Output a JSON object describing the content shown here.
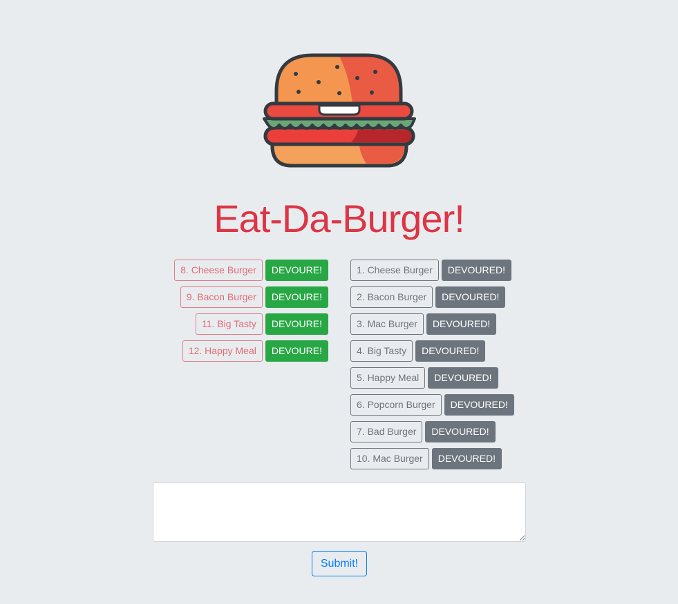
{
  "title": "Eat-Da-Burger!",
  "logo_icon": "burger-icon",
  "colors": {
    "title": "#dc3545",
    "devour_button": "#28a745",
    "devoured_button": "#6c757d",
    "submit_accent": "#007bff",
    "background": "#e9ecef"
  },
  "pending_burgers": [
    {
      "name": "8. Cheese Burger",
      "action": "DEVOURE!"
    },
    {
      "name": "9. Bacon Burger",
      "action": "DEVOURE!"
    },
    {
      "name": "11. Big Tasty",
      "action": "DEVOURE!"
    },
    {
      "name": "12. Happy Meal",
      "action": "DEVOURE!"
    }
  ],
  "devoured_burgers": [
    {
      "name": "1. Cheese Burger",
      "action": "DEVOURED!"
    },
    {
      "name": "2. Bacon Burger",
      "action": "DEVOURED!"
    },
    {
      "name": "3. Mac Burger",
      "action": "DEVOURED!"
    },
    {
      "name": "4. Big Tasty",
      "action": "DEVOURED!"
    },
    {
      "name": "5. Happy Meal",
      "action": "DEVOURED!"
    },
    {
      "name": "6. Popcorn Burger",
      "action": "DEVOURED!"
    },
    {
      "name": "7. Bad Burger",
      "action": "DEVOURED!"
    },
    {
      "name": "10. Mac Burger",
      "action": "DEVOURED!"
    }
  ],
  "form": {
    "textarea_value": "",
    "submit_label": "Submit!"
  }
}
